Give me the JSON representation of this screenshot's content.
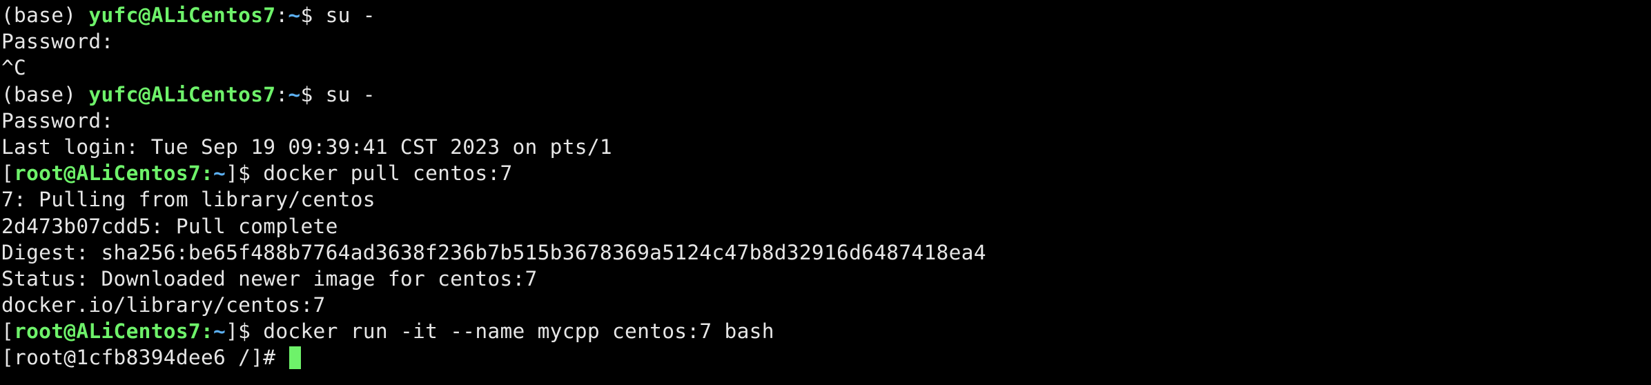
{
  "terminal": {
    "lines": [
      {
        "pre": "(base) ",
        "user_host": "yufc@ALiCentos7",
        "colon": ":",
        "path": "~",
        "post": "$ su -"
      },
      {
        "text": "Password:"
      },
      {
        "text": "^C"
      },
      {
        "pre": "(base) ",
        "user_host": "yufc@ALiCentos7",
        "colon": ":",
        "path": "~",
        "post": "$ su -"
      },
      {
        "text": "Password:"
      },
      {
        "text": "Last login: Tue Sep 19 09:39:41 CST 2023 on pts/1"
      },
      {
        "pre": "[",
        "user_host": "root@ALiCentos7",
        "colon": ":",
        "path": "~",
        "post": "]$ docker pull centos:7"
      },
      {
        "text": "7: Pulling from library/centos"
      },
      {
        "text": "2d473b07cdd5: Pull complete"
      },
      {
        "text": "Digest: sha256:be65f488b7764ad3638f236b7b515b3678369a5124c47b8d32916d6487418ea4"
      },
      {
        "text": "Status: Downloaded newer image for centos:7"
      },
      {
        "text": "docker.io/library/centos:7"
      },
      {
        "pre": "[",
        "user_host": "root@ALiCentos7",
        "colon": ":",
        "path": "~",
        "post": "]$ docker run -it --name mycpp centos:7 bash"
      },
      {
        "text": "[root@1cfb8394dee6 /]# "
      }
    ],
    "colors": {
      "prompt_user": "#6ef26a",
      "prompt_path": "#5cb0f2",
      "text": "#e6e6e6",
      "background": "#000000",
      "cursor": "#6ef26a"
    }
  }
}
